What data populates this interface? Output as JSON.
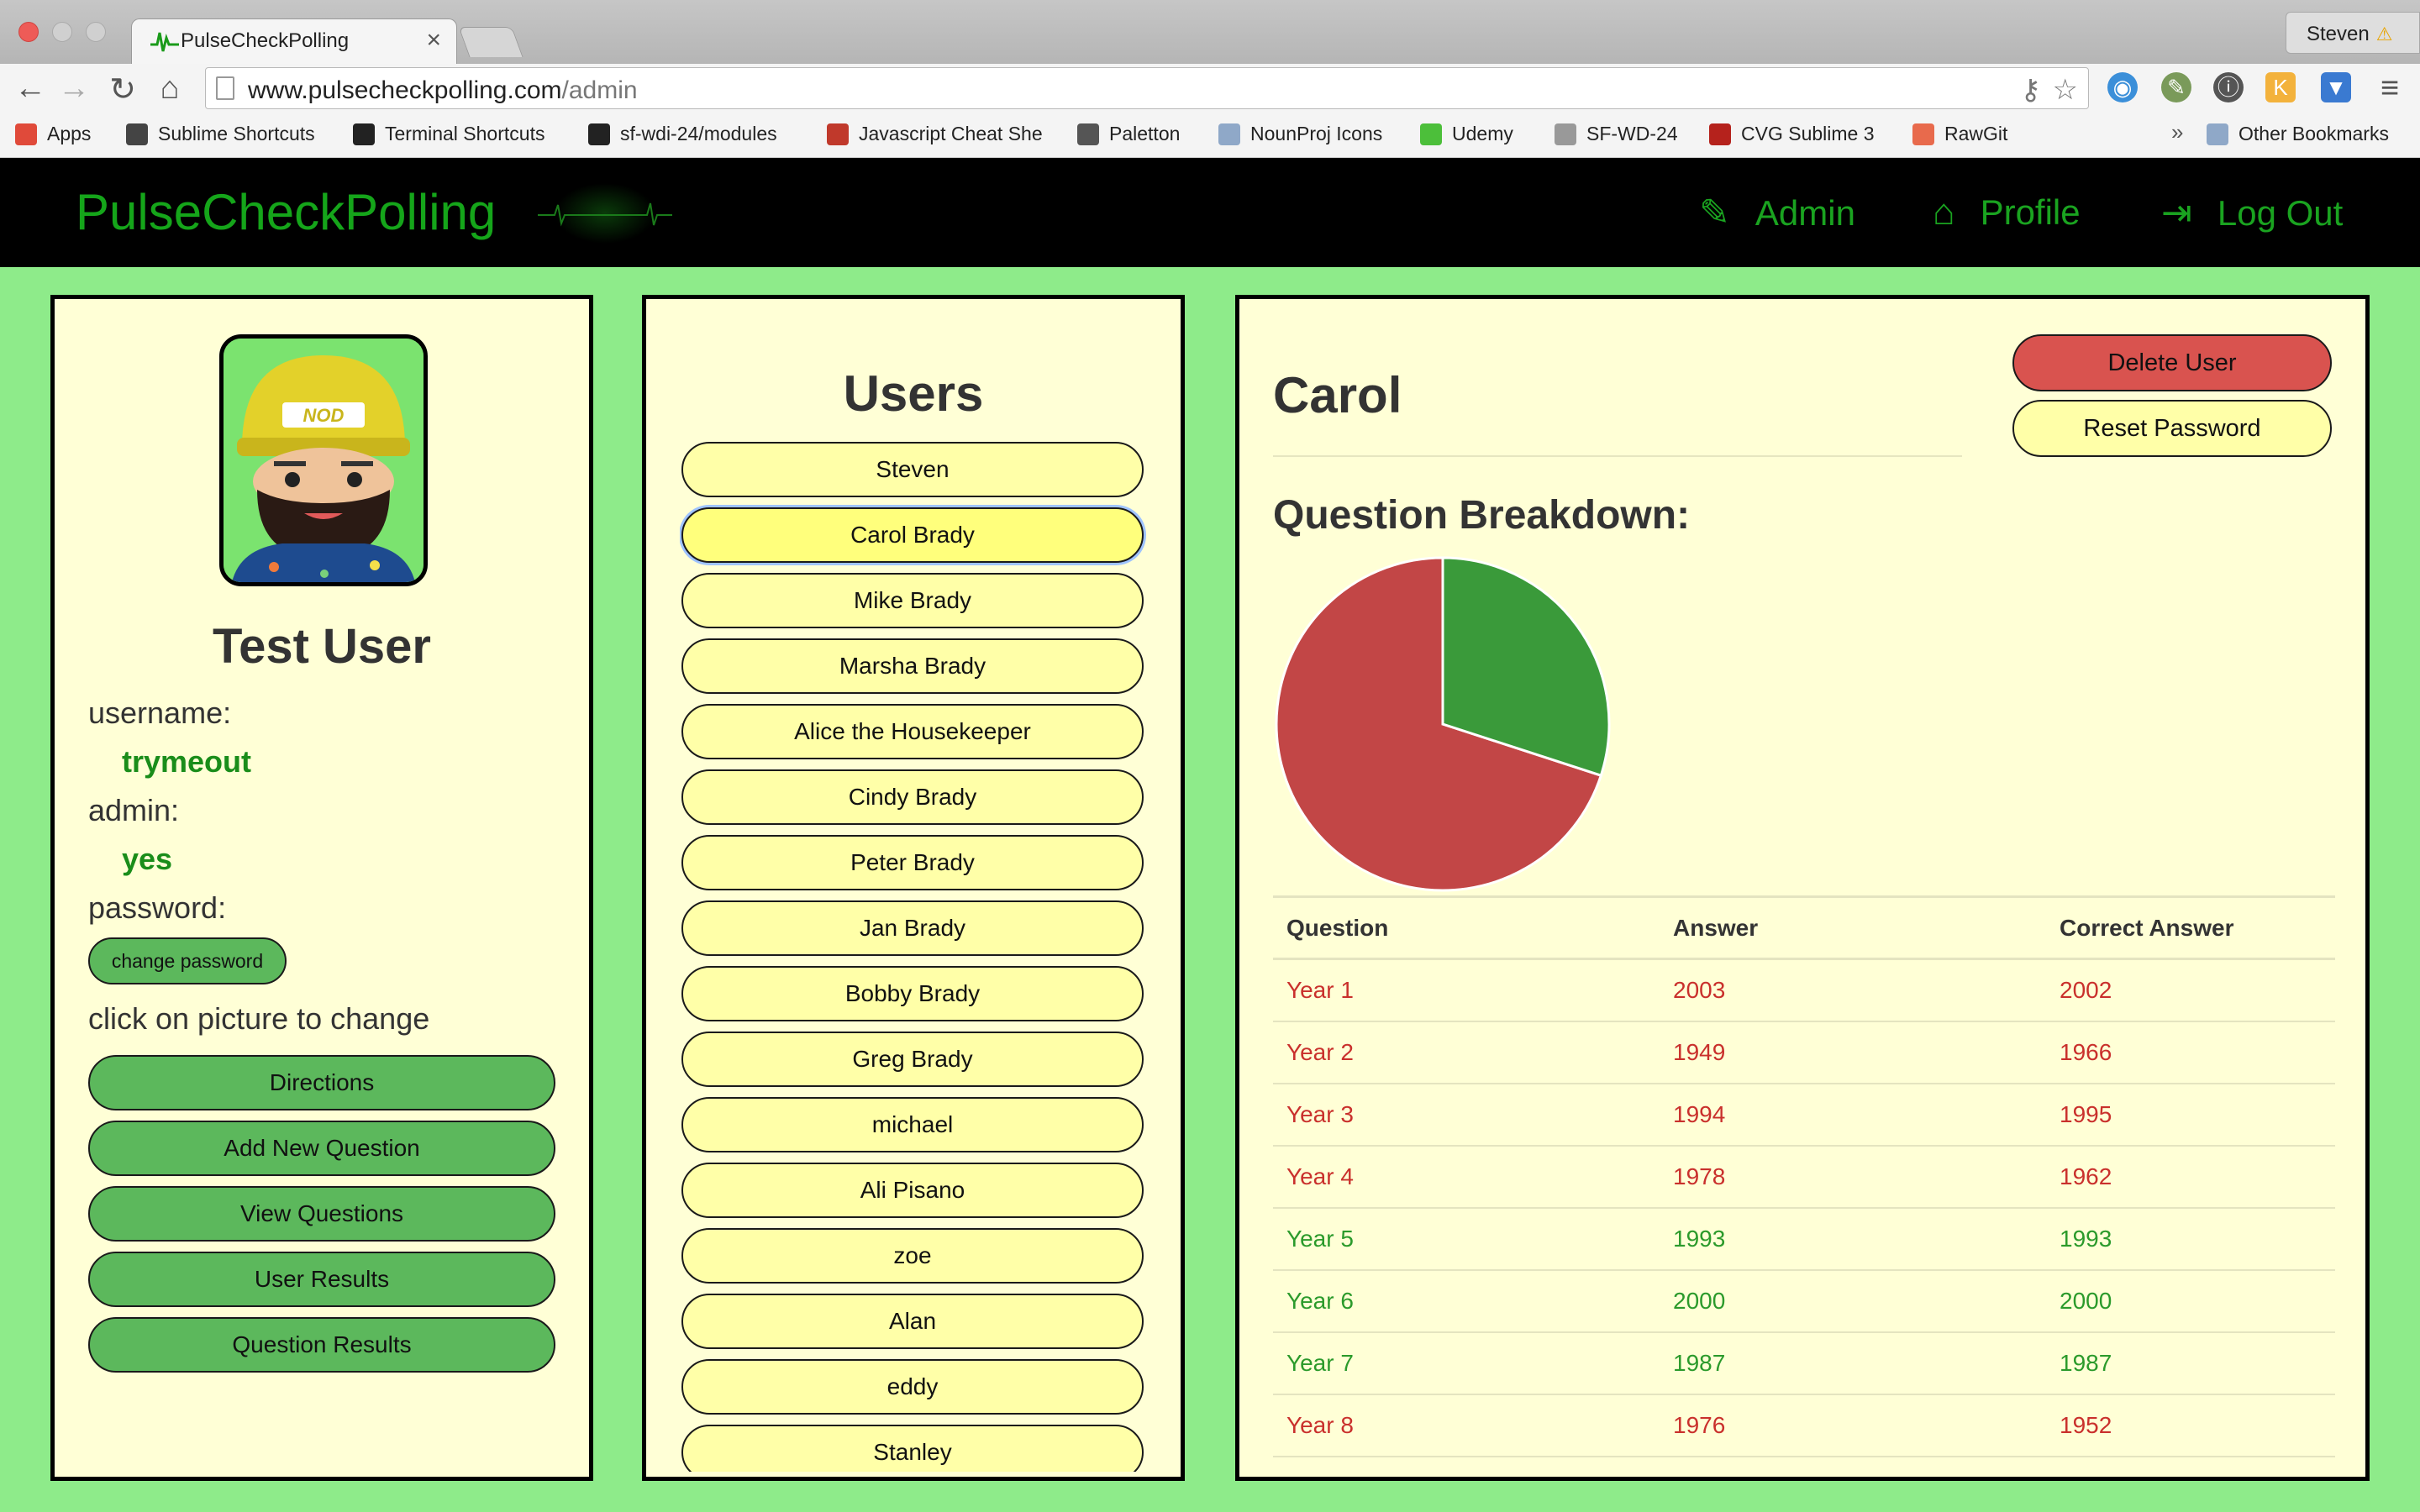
{
  "browser": {
    "tab_title": "PulseCheckPolling",
    "tab_close": "×",
    "profile_name": "Steven",
    "url_host": "www.pulsecheckpolling.com",
    "url_path": "/admin",
    "bookmarks": [
      {
        "label": "Apps",
        "icon": "apps-grid-icon",
        "color": "#e04a3a"
      },
      {
        "label": "Sublime Shortcuts",
        "icon": "doc-icon",
        "color": "#444444"
      },
      {
        "label": "Terminal Shortcuts",
        "icon": "github-icon",
        "color": "#222222"
      },
      {
        "label": "sf-wdi-24/modules",
        "icon": "github-icon",
        "color": "#222222"
      },
      {
        "label": "Javascript Cheat She",
        "icon": "book-icon",
        "color": "#c0392b"
      },
      {
        "label": "Paletton",
        "icon": "palette-icon",
        "color": "#555555"
      },
      {
        "label": "NounProj Icons",
        "icon": "folder-icon",
        "color": "#8fa8c8"
      },
      {
        "label": "Udemy",
        "icon": "udemy-icon",
        "color": "#4cbf3a"
      },
      {
        "label": "SF-WD-24",
        "icon": "page-icon",
        "color": "#999999"
      },
      {
        "label": "CVG Sublime 3",
        "icon": "cvg-icon",
        "color": "#b5221c"
      },
      {
        "label": "RawGit",
        "icon": "sushi-icon",
        "color": "#e86a4c"
      }
    ],
    "bookmarks_overflow": "»",
    "other_bookmarks": "Other Bookmarks"
  },
  "nav": {
    "brand": "PulseCheckPolling",
    "links": [
      {
        "label": "Admin",
        "icon": "wrench-icon"
      },
      {
        "label": "Profile",
        "icon": "home-icon"
      },
      {
        "label": "Log Out",
        "icon": "logout-icon"
      }
    ]
  },
  "profile": {
    "avatar_badge": "NOD",
    "display_name": "Test User",
    "username_label": "username:",
    "username": "trymeout",
    "admin_label": "admin:",
    "admin_value": "yes",
    "password_label": "password:",
    "change_password": "change password",
    "picture_hint": "click on picture to change",
    "actions": [
      "Directions",
      "Add New Question",
      "View Questions",
      "User Results",
      "Question Results"
    ]
  },
  "users": {
    "title": "Users",
    "selected_index": 1,
    "list": [
      "Steven",
      "Carol Brady",
      "Mike Brady",
      "Marsha Brady",
      "Alice the Housekeeper",
      "Cindy Brady",
      "Peter Brady",
      "Jan Brady",
      "Bobby Brady",
      "Greg Brady",
      "michael",
      "Ali Pisano",
      "zoe",
      "Alan",
      "eddy",
      "Stanley"
    ]
  },
  "detail": {
    "name": "Carol",
    "delete_label": "Delete User",
    "reset_label": "Reset Password",
    "breakdown_title": "Question Breakdown:",
    "pie": {
      "correct_fraction": 0.3,
      "correct_color": "#3a9a3a",
      "wrong_color": "#c24646"
    },
    "table_headers": [
      "Question",
      "Answer",
      "Correct Answer"
    ],
    "rows": [
      {
        "question": "Year 1",
        "answer": "2003",
        "correct": "2002",
        "is_correct": false
      },
      {
        "question": "Year 2",
        "answer": "1949",
        "correct": "1966",
        "is_correct": false
      },
      {
        "question": "Year 3",
        "answer": "1994",
        "correct": "1995",
        "is_correct": false
      },
      {
        "question": "Year 4",
        "answer": "1978",
        "correct": "1962",
        "is_correct": false
      },
      {
        "question": "Year 5",
        "answer": "1993",
        "correct": "1993",
        "is_correct": true
      },
      {
        "question": "Year 6",
        "answer": "2000",
        "correct": "2000",
        "is_correct": true
      },
      {
        "question": "Year 7",
        "answer": "1987",
        "correct": "1987",
        "is_correct": true
      },
      {
        "question": "Year 8",
        "answer": "1976",
        "correct": "1952",
        "is_correct": false
      }
    ]
  }
}
